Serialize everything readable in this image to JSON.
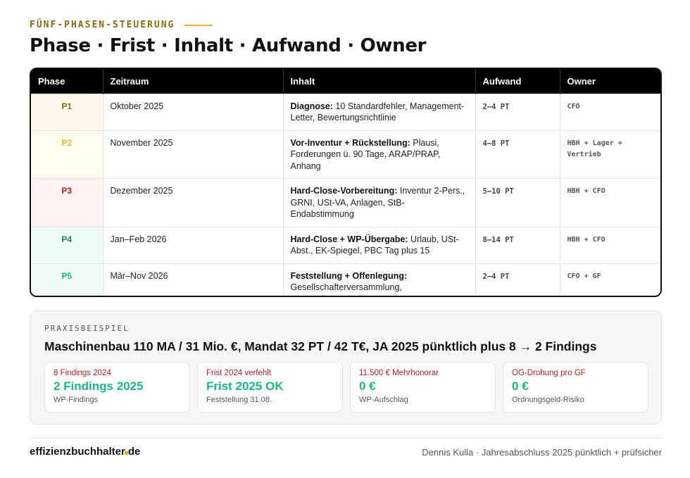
{
  "header": {
    "eyebrow": "FÜNF-PHASEN-STEUERUNG",
    "title": "Phase · Frist · Inhalt · Aufwand · Owner"
  },
  "table": {
    "columns": [
      "Phase",
      "Zeitraum",
      "Inhalt",
      "Aufwand",
      "Owner"
    ],
    "rows": [
      {
        "phase": "P1",
        "zeitraum": "Oktober 2025",
        "inhalt_bold": "Diagnose:",
        "inhalt_rest": " 10 Standardfehler, Management-Letter, Bewertungsrichtlinie",
        "aufwand": "2–4 PT",
        "owner": "CFO"
      },
      {
        "phase": "P2",
        "zeitraum": "November 2025",
        "inhalt_bold": "Vor-Inventur + Rückstellung:",
        "inhalt_rest": " Plausi, Forderungen ü. 90 Tage, ARAP/PRAP, Anhang",
        "aufwand": "4–8 PT",
        "owner": "HBH + Lager + Vertrieb"
      },
      {
        "phase": "P3",
        "zeitraum": "Dezember 2025",
        "inhalt_bold": "Hard-Close-Vorbereitung:",
        "inhalt_rest": " Inventur 2-Pers., GRNI, USt-VA, Anlagen, StB-Endabstimmung",
        "aufwand": "5–10 PT",
        "owner": "HBH + CFO"
      },
      {
        "phase": "P4",
        "zeitraum": "Jan–Feb 2026",
        "inhalt_bold": "Hard-Close + WP-Übergabe:",
        "inhalt_rest": " Urlaub, USt-Abst., EK-Spiegel, PBC Tag plus 15",
        "aufwand": "8–14 PT",
        "owner": "HBH + CFO"
      },
      {
        "phase": "P5",
        "zeitraum": "Mär–Nov 2026",
        "inhalt_bold": "Feststellung + Offenlegung:",
        "inhalt_rest": " Gesellschafterversammlung, Unternehmensregister",
        "aufwand": "2–4 PT",
        "owner": "CFO + GF"
      }
    ],
    "phase_colors": {
      "P1": {
        "text": "#8a6a12",
        "bg": "#fdf8ea"
      },
      "P2": {
        "text": "#e8b830",
        "bg": "#fffaee"
      },
      "P3": {
        "text": "#b02020",
        "bg": "#fdf1f1"
      },
      "P4": {
        "text": "#128a5c",
        "bg": "#eefaf4"
      },
      "P5": {
        "text": "#17b884",
        "bg": "#f1fbf7"
      }
    }
  },
  "example": {
    "eyebrow": "PRAXISBEISPIEL",
    "headline": "Maschinenbau 110 MA / 31 Mio. €, Mandat 32 PT / 42 T€, JA 2025 pünktlich plus 8 → 2 Findings",
    "kpis": [
      {
        "top": "8 Findings 2024",
        "main": "2 Findings 2025",
        "sub": "WP-Findings"
      },
      {
        "top": "Frist 2024 verfehlt",
        "main": "Frist 2025 OK",
        "sub": "Feststellung 31.08."
      },
      {
        "top": "11.500 € Mehrhonorar",
        "main": "0 €",
        "sub": "WP-Aufschlag"
      },
      {
        "top": "OG-Drohung pro GF",
        "main": "0 €",
        "sub": "Ordnungsgeld-Risiko"
      }
    ]
  },
  "footer": {
    "brand": "effizienzbuchhalter",
    "brand_suffix": "de",
    "right": "Dennis Kulla · Jahresabschluss 2025 pünktlich + prüfsicher"
  }
}
